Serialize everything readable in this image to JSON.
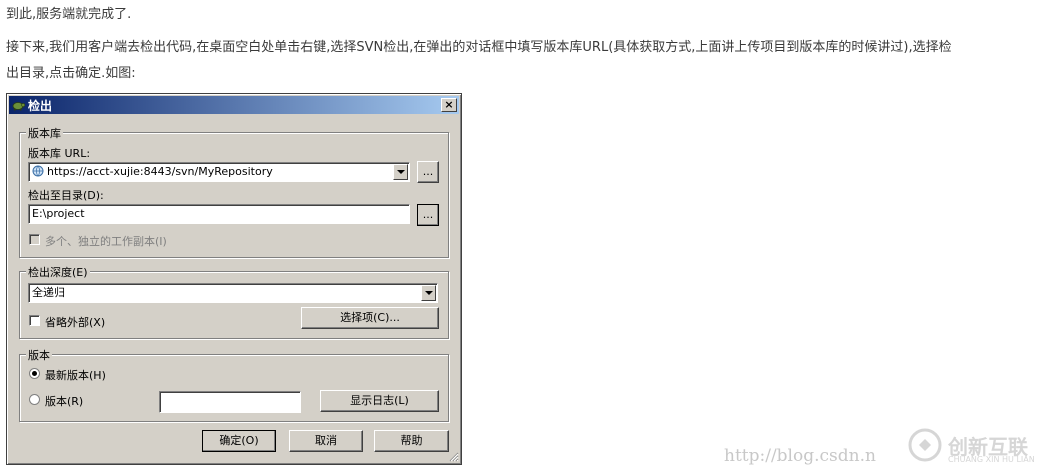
{
  "article": {
    "line1": "到此,服务端就完成了.",
    "line2": "接下来,我们用客户端去检出代码,在桌面空白处单击右键,选择SVN检出,在弹出的对话框中填写版本库URL(具体获取方式,上面讲上传项目到版本库的时候讲过),选择检",
    "line3": "出目录,点击确定.如图:"
  },
  "dialog": {
    "title": "检出",
    "close_label": "×",
    "repo_group": {
      "title": "版本库",
      "url_label": "版本库 URL:",
      "url_value": "https://acct-xujie:8443/svn/MyRepository",
      "browse_label": "...",
      "dir_label": "检出至目录(D):",
      "dir_value": "E:\\project",
      "dir_browse_label": "...",
      "multi_label": "多个、独立的工作副本(I)"
    },
    "depth_group": {
      "title": "检出深度(E)",
      "depth_value": "全递归",
      "omit_external_label": "省略外部(X)",
      "options_button": "选择项(C)..."
    },
    "revision_group": {
      "title": "版本",
      "head_label": "最新版本(H)",
      "revision_label": "版本(R)",
      "revision_value": "",
      "show_log_button": "显示日志(L)"
    },
    "ok_button": "确定(O)",
    "cancel_button": "取消",
    "help_button": "帮助"
  },
  "watermark": {
    "url_text": "http://blog.csdn.n",
    "brand_name": "创新互联",
    "brand_sub": "CHUANG XIN HU LIAN"
  },
  "colors": {
    "titlebar_start": "#0a246a",
    "titlebar_end": "#a6caf0",
    "dialog_bg": "#d4d0c8"
  }
}
